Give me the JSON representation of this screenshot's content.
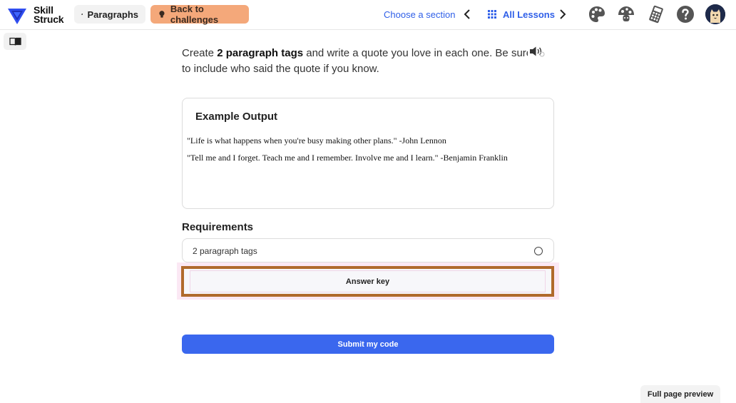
{
  "brand": {
    "line1": "Skill",
    "line2": "Struck"
  },
  "header": {
    "lesson_chip": "Paragraphs",
    "back_chip": "Back to challenges",
    "choose_section": "Choose a section",
    "all_lessons": "All Lessons",
    "icons": [
      "palette-icon",
      "mushroom-icon",
      "calculator-icon",
      "help-icon",
      "avatar"
    ]
  },
  "instructions": {
    "prefix": "Create ",
    "bold": "2 paragraph tags",
    "suffix": " and write a quote you love in each one. Be sure to include who said the quote if you know."
  },
  "example": {
    "title": "Example Output",
    "lines": [
      "\"Life is what happens when you're busy making other plans.\" -John Lennon",
      "\"Tell me and I forget. Teach me and I remember. Involve me and I learn.\" -Benjamin Franklin"
    ]
  },
  "requirements": {
    "title": "Requirements",
    "items": [
      {
        "label": "2 paragraph tags",
        "done": false
      }
    ]
  },
  "answer_key_label": "Answer key",
  "submit_label": "Submit my code",
  "full_page_preview_label": "Full page preview",
  "colors": {
    "accent_blue": "#3a67ee",
    "back_chip": "#f4a87a",
    "highlight_border": "#b06a2c"
  }
}
